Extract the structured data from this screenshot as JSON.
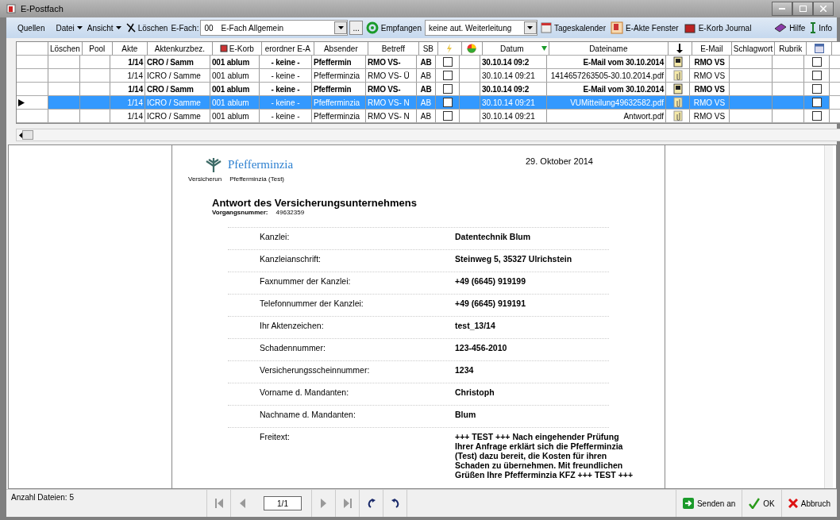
{
  "window": {
    "title": "E-Postfach"
  },
  "toolbar": {
    "sources": "Quellen",
    "menus": [
      {
        "label": "Datei"
      },
      {
        "label": "Ansicht"
      }
    ],
    "delete": "Löschen",
    "efach_label": "E-Fach:",
    "efach_code": "00",
    "efach_name": "E-Fach Allgemein",
    "browse": "...",
    "receive": "Empfangen",
    "forwarding": "keine aut. Weiterleitung",
    "calendar": "Tageskalender",
    "eakte": "E-Akte Fenster",
    "journal": "E-Korb Journal",
    "help": "Hilfe",
    "info": "Info"
  },
  "table": {
    "columns": [
      {
        "kind": "text"
      },
      {
        "label": "Löschen",
        "kind": "text"
      },
      {
        "label": "Pool",
        "kind": "text"
      },
      {
        "label": "Akte",
        "kind": "text"
      },
      {
        "label": "Aktenkurzbez.",
        "kind": "text"
      },
      {
        "label": "E-Korb",
        "kind": "basket"
      },
      {
        "label": "erordner E-A",
        "kind": "text"
      },
      {
        "label": "Absender",
        "kind": "text"
      },
      {
        "label": "Betreff",
        "kind": "text"
      },
      {
        "label": "SB",
        "kind": "text"
      },
      {
        "kind": "flash"
      },
      {
        "kind": "traffic"
      },
      {
        "label": "Datum",
        "kind": "sorted"
      },
      {
        "label": "Dateiname",
        "kind": "text"
      },
      {
        "kind": "arrow"
      },
      {
        "label": "E-Mail",
        "kind": "text"
      },
      {
        "label": "Schlagwort",
        "kind": "text"
      },
      {
        "label": "Rubrik",
        "kind": "text"
      },
      {
        "kind": "calendar"
      }
    ],
    "rows": [
      {
        "selected": false,
        "bold": true,
        "kind": "email",
        "akte": "1/14",
        "kurz": "CRO / Samm",
        "korb": "001 ablum",
        "ordner": "- keine -",
        "absender": "Pfeffermin",
        "betreff": "RMO VS-",
        "sb": "AB",
        "flag": false,
        "datum": "30.10.14 09:2",
        "datei": "E-Mail vom 30.10.2014",
        "email": "RMO VS",
        "mark": false
      },
      {
        "selected": false,
        "bold": false,
        "kind": "attachment",
        "akte": "1/14",
        "kurz": "ICRO / Samme",
        "korb": "001 ablum",
        "ordner": "- keine -",
        "absender": "Pfefferminzia",
        "betreff": "RMO VS- Ü",
        "sb": "AB",
        "flag": false,
        "datum": "30.10.14 09:21",
        "datei": "1414657263505-30.10.2014.pdf",
        "email": "RMO VS",
        "mark": false
      },
      {
        "selected": false,
        "bold": true,
        "kind": "email",
        "akte": "1/14",
        "kurz": "CRO / Samm",
        "korb": "001 ablum",
        "ordner": "- keine -",
        "absender": "Pfeffermin",
        "betreff": "RMO VS-",
        "sb": "AB",
        "flag": false,
        "datum": "30.10.14 09:2",
        "datei": "E-Mail vom 30.10.2014",
        "email": "RMO VS",
        "mark": false
      },
      {
        "selected": true,
        "bold": false,
        "kind": "attachment",
        "akte": "1/14",
        "kurz": "ICRO / Samme",
        "korb": "001 ablum",
        "ordner": "- keine -",
        "absender": "Pfefferminzia",
        "betreff": "RMO VS- N",
        "sb": "AB",
        "flag": false,
        "datum": "30.10.14 09:21",
        "datei": "VUMitteilung49632582.pdf",
        "email": "RMO VS",
        "mark": false
      },
      {
        "selected": false,
        "bold": false,
        "kind": "attachment",
        "akte": "1/14",
        "kurz": "ICRO / Samme",
        "korb": "001 ablum",
        "ordner": "- keine -",
        "absender": "Pfefferminzia",
        "betreff": "RMO VS- N",
        "sb": "AB",
        "flag": false,
        "datum": "30.10.14 09:21",
        "datei": "Antwort.pdf",
        "email": "RMO VS",
        "mark": false
      }
    ]
  },
  "document": {
    "brand": "Pfefferminzia",
    "sender_label": "Versicherun",
    "sender": "Pfefferminzia (Test)",
    "date": "29. Oktober 2014",
    "heading": "Antwort des Versicherungsunternehmens",
    "ref_label": "Vorgangsnummer:",
    "ref": "49632359",
    "fields": [
      {
        "label": "Kanzlei:",
        "value": "Datentechnik Blum"
      },
      {
        "label": "Kanzleianschrift:",
        "value": "Steinweg 5, 35327 Ulrichstein"
      },
      {
        "label": "Faxnummer der Kanzlei:",
        "value": "+49 (6645) 919199"
      },
      {
        "label": "Telefonnummer der Kanzlei:",
        "value": "+49 (6645) 919191"
      },
      {
        "label": "Ihr Aktenzeichen:",
        "value": "test_13/14"
      },
      {
        "label": "Schadennummer:",
        "value": "123-456-2010"
      },
      {
        "label": "Versicherungsscheinnummer:",
        "value": "1234"
      },
      {
        "label": "Vorname d. Mandanten:",
        "value": "Christoph"
      },
      {
        "label": "Nachname d. Mandanten:",
        "value": "Blum"
      },
      {
        "label": "Freitext:",
        "value": "+++ TEST +++ Nach eingehender Prüfung Ihrer Anfrage erklärt sich die Pfefferminzia (Test) dazu bereit, die Kosten für ihren Schaden zu übernehmen. Mit freundlichen Grüßen Ihre Pfefferminzia KFZ +++ TEST +++"
      }
    ]
  },
  "status_bar": {
    "count": "Anzahl Dateien: 5",
    "page": "1/1",
    "buttons": [
      {
        "label": "Senden an",
        "kind": "send"
      },
      {
        "label": "OK",
        "kind": "ok"
      },
      {
        "label": "Abbruch",
        "kind": "cancel"
      }
    ]
  }
}
